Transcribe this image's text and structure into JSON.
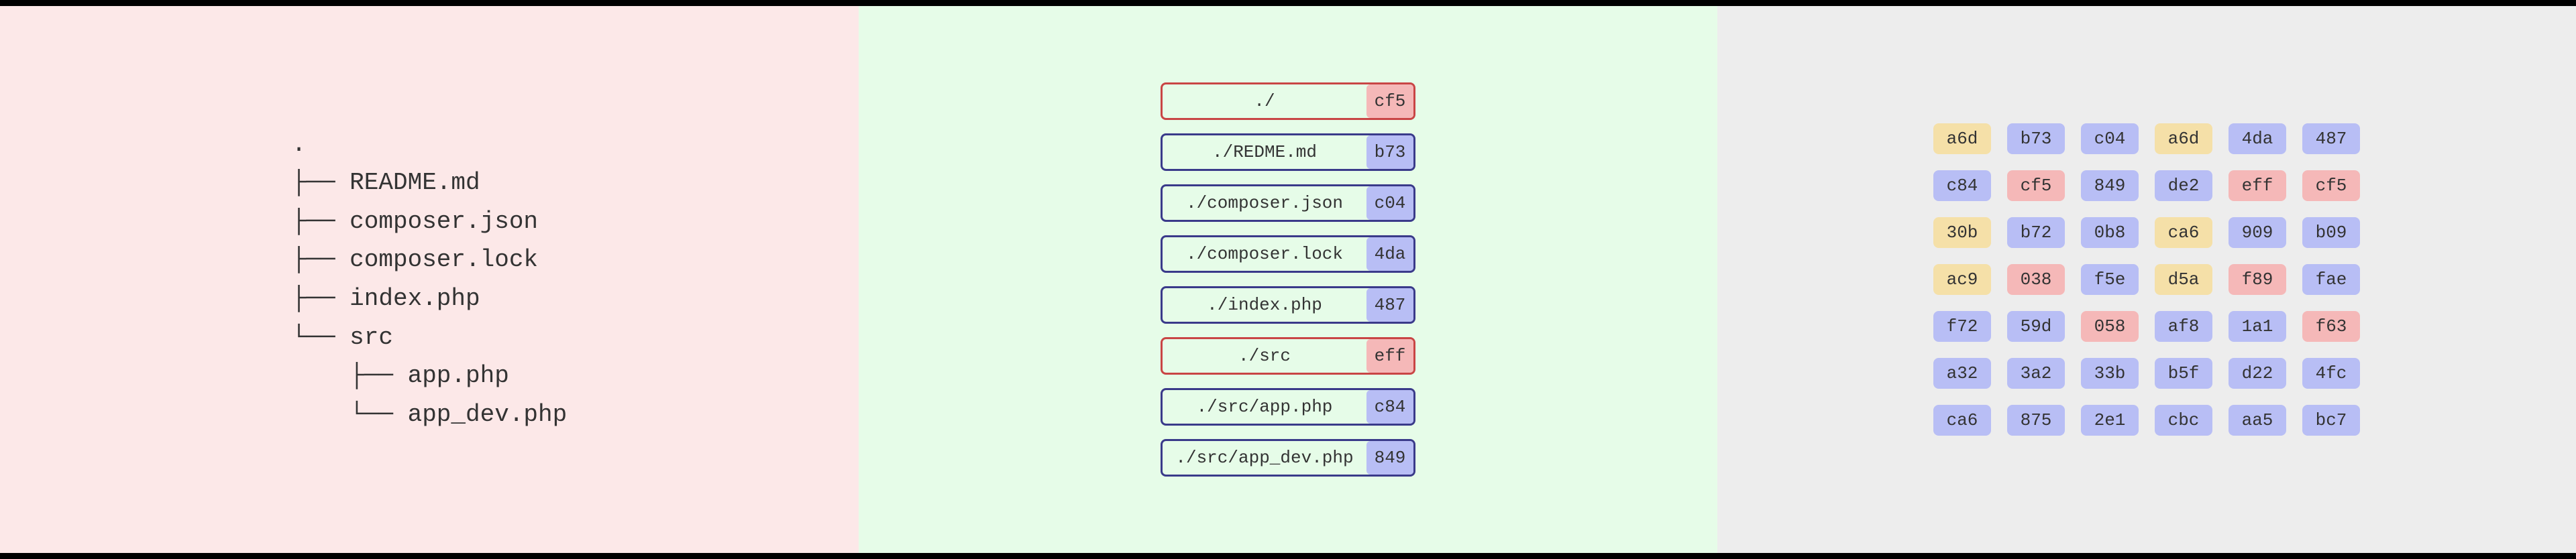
{
  "tree": {
    "root": ".",
    "lines": [
      "├── README.md",
      "├── composer.json",
      "├── composer.lock",
      "├── index.php",
      "└── src",
      "    ├── app.php",
      "    └── app_dev.php"
    ]
  },
  "files": [
    {
      "path": "./",
      "hash": "cf5",
      "type": "dir",
      "hashColor": "red"
    },
    {
      "path": "./REDME.md",
      "hash": "b73",
      "type": "file",
      "hashColor": "blue"
    },
    {
      "path": "./composer.json",
      "hash": "c04",
      "type": "file",
      "hashColor": "blue"
    },
    {
      "path": "./composer.lock",
      "hash": "4da",
      "type": "file",
      "hashColor": "blue"
    },
    {
      "path": "./index.php",
      "hash": "487",
      "type": "file",
      "hashColor": "blue"
    },
    {
      "path": "./src",
      "hash": "eff",
      "type": "dir",
      "hashColor": "red"
    },
    {
      "path": "./src/app.php",
      "hash": "c84",
      "type": "file",
      "hashColor": "blue"
    },
    {
      "path": "./src/app_dev.php",
      "hash": "849",
      "type": "file",
      "hashColor": "blue"
    }
  ],
  "grid": [
    [
      {
        "v": "a6d",
        "c": "yellow"
      },
      {
        "v": "b73",
        "c": "blue"
      },
      {
        "v": "c04",
        "c": "blue"
      },
      {
        "v": "a6d",
        "c": "yellow"
      },
      {
        "v": "4da",
        "c": "blue"
      },
      {
        "v": "487",
        "c": "blue"
      }
    ],
    [
      {
        "v": "c84",
        "c": "blue"
      },
      {
        "v": "cf5",
        "c": "red"
      },
      {
        "v": "849",
        "c": "blue"
      },
      {
        "v": "de2",
        "c": "blue"
      },
      {
        "v": "eff",
        "c": "red"
      },
      {
        "v": "cf5",
        "c": "red"
      }
    ],
    [
      {
        "v": "30b",
        "c": "yellow"
      },
      {
        "v": "b72",
        "c": "blue"
      },
      {
        "v": "0b8",
        "c": "blue"
      },
      {
        "v": "ca6",
        "c": "yellow"
      },
      {
        "v": "909",
        "c": "blue"
      },
      {
        "v": "b09",
        "c": "blue"
      }
    ],
    [
      {
        "v": "ac9",
        "c": "yellow"
      },
      {
        "v": "038",
        "c": "red"
      },
      {
        "v": "f5e",
        "c": "blue"
      },
      {
        "v": "d5a",
        "c": "yellow"
      },
      {
        "v": "f89",
        "c": "red"
      },
      {
        "v": "fae",
        "c": "blue"
      }
    ],
    [
      {
        "v": "f72",
        "c": "blue"
      },
      {
        "v": "59d",
        "c": "blue"
      },
      {
        "v": "058",
        "c": "red"
      },
      {
        "v": "af8",
        "c": "blue"
      },
      {
        "v": "1a1",
        "c": "blue"
      },
      {
        "v": "f63",
        "c": "red"
      }
    ],
    [
      {
        "v": "a32",
        "c": "blue"
      },
      {
        "v": "3a2",
        "c": "blue"
      },
      {
        "v": "33b",
        "c": "blue"
      },
      {
        "v": "b5f",
        "c": "blue"
      },
      {
        "v": "d22",
        "c": "blue"
      },
      {
        "v": "4fc",
        "c": "blue"
      }
    ],
    [
      {
        "v": "ca6",
        "c": "blue"
      },
      {
        "v": "875",
        "c": "blue"
      },
      {
        "v": "2e1",
        "c": "blue"
      },
      {
        "v": "cbc",
        "c": "blue"
      },
      {
        "v": "aa5",
        "c": "blue"
      },
      {
        "v": "bc7",
        "c": "blue"
      }
    ]
  ]
}
